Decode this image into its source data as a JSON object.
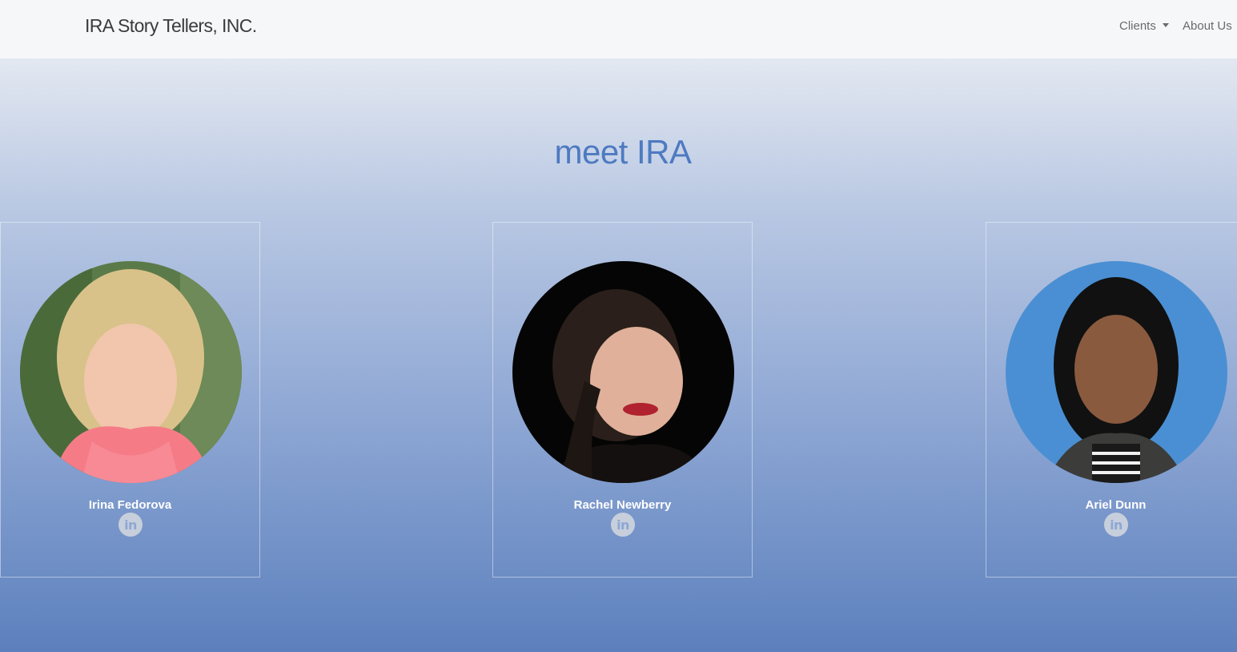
{
  "navbar": {
    "brand": "IRA Story Tellers, INC.",
    "items": [
      {
        "label": "Clients"
      },
      {
        "label": "About Us"
      }
    ]
  },
  "main": {
    "heading": "meet IRA",
    "team": [
      {
        "name": "Irina Fedorova",
        "link_icon": "linkedin-icon",
        "link_text": "in"
      },
      {
        "name": "Rachel Newberry",
        "link_icon": "linkedin-icon",
        "link_text": "in"
      },
      {
        "name": "Ariel Dunn",
        "link_icon": "linkedin-icon",
        "link_text": "in"
      }
    ]
  },
  "colors": {
    "heading": "#4e7ac1",
    "linkedin_bg": "#c7cfdc",
    "gradient_bottom": "#5c80bd"
  }
}
